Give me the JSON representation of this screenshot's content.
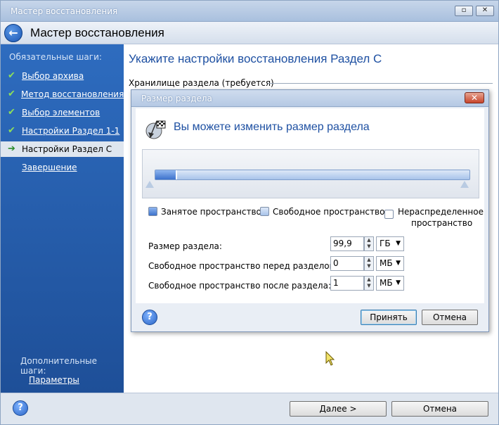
{
  "window": {
    "title": "Мастер восстановления"
  },
  "header": {
    "title": "Мастер восстановления"
  },
  "sidebar": {
    "required_title": "Обязательные шаги:",
    "items": [
      {
        "label": "Выбор архива",
        "done": true
      },
      {
        "label": "Метод восстановления",
        "done": true
      },
      {
        "label": "Выбор элементов",
        "done": true
      },
      {
        "label": "Настройки Раздел 1-1",
        "done": true
      },
      {
        "label": "Настройки Раздел C",
        "active": true
      },
      {
        "label": "Завершение"
      }
    ],
    "optional_title": "Дополнительные шаги:",
    "optional_items": [
      {
        "label": "Параметры"
      }
    ]
  },
  "main": {
    "title": "Укажите настройки восстановления Раздел С",
    "section": "Хранилище раздела (требуется)"
  },
  "footer": {
    "next_label": "Далее >",
    "cancel_label": "Отмена"
  },
  "dialog": {
    "title": "Размер раздела",
    "heading": "Вы можете изменить размер раздела",
    "bar": {
      "used_fraction": 0.07
    },
    "legend": {
      "used": "Занятое пространство",
      "free": "Свободное пространство",
      "unallocated_1": "Нераспределенное",
      "unallocated_2": "пространство"
    },
    "fields": [
      {
        "label": "Размер раздела:",
        "value": "99,9",
        "unit": "ГБ"
      },
      {
        "label": "Свободное пространство перед разделом:",
        "value": "0",
        "unit": "МБ"
      },
      {
        "label": "Свободное пространство после раздела:",
        "value": "1",
        "unit": "МБ"
      }
    ],
    "ok_label": "Принять",
    "cancel_label": "Отмена"
  },
  "colors": {
    "accent": "#1e50a2",
    "sidebar": "#2e6cbf"
  }
}
